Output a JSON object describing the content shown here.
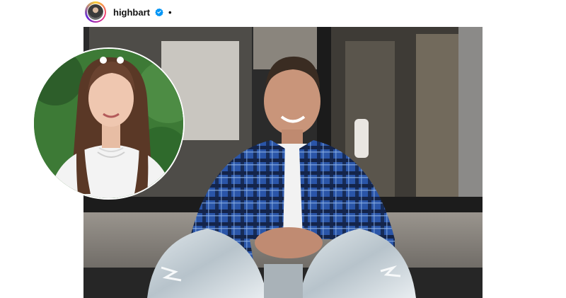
{
  "post": {
    "username": "highbart",
    "verified": true,
    "separator": "•",
    "icons": {
      "avatar": "profile-avatar-icon",
      "verified": "verified-badge-icon"
    },
    "colors": {
      "verified_blue": "#0095f6",
      "story_ring": [
        "#f9ce34",
        "#ee2a7b",
        "#6228d7"
      ]
    }
  },
  "media": {
    "main_photo": "man-in-blue-plaid-shirt-seated",
    "inset_photo": "young-woman-portrait-circle"
  }
}
